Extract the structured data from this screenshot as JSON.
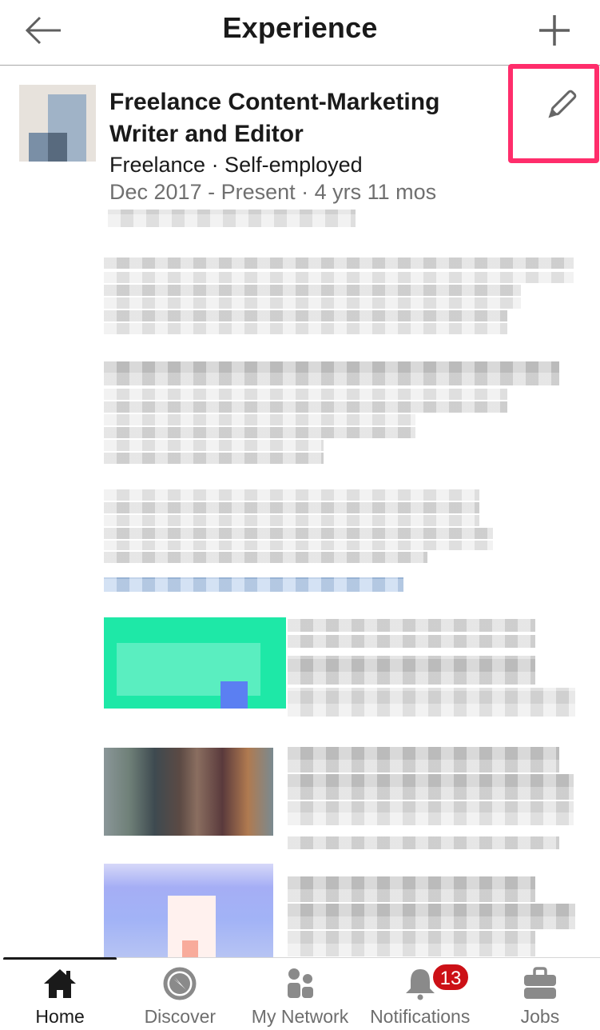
{
  "header": {
    "title": "Experience",
    "back_icon": "arrow-left-icon",
    "add_icon": "plus-icon"
  },
  "experience": {
    "title": "Freelance Content-Marketing Writer and Editor",
    "company_line": "Freelance · Self-employed",
    "dates_line": "Dec 2017 - Present · 4 yrs 11 mos",
    "edit_icon": "pencil-icon",
    "location_redacted": true,
    "description_redacted": true,
    "media_items_redacted": 3
  },
  "highlight": {
    "color": "#ff2d6b",
    "target": "edit-button"
  },
  "tabbar": {
    "items": [
      {
        "label": "Home",
        "icon": "home-icon",
        "active": true
      },
      {
        "label": "Discover",
        "icon": "compass-icon",
        "active": false
      },
      {
        "label": "My Network",
        "icon": "people-icon",
        "active": false
      },
      {
        "label": "Notifications",
        "icon": "bell-icon",
        "active": false,
        "badge": "13"
      },
      {
        "label": "Jobs",
        "icon": "briefcase-icon",
        "active": false
      }
    ]
  },
  "colors": {
    "text_primary": "#1a1a1a",
    "text_secondary": "#6f6f6f",
    "icon_gray": "#6e6e6e",
    "badge_red": "#cc1016"
  }
}
